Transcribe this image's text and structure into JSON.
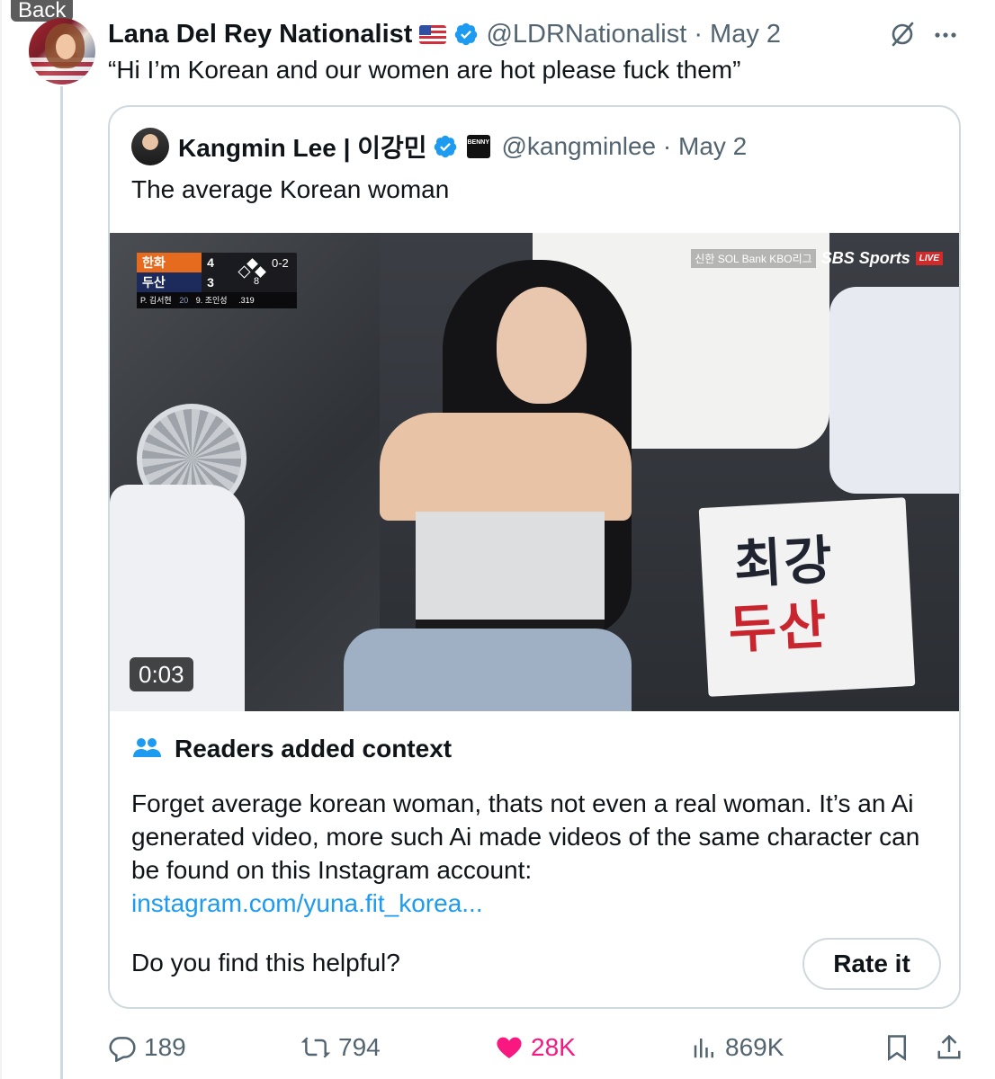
{
  "nav": {
    "back_label": "Back"
  },
  "tweet": {
    "display_name": "Lana Del Rey Nationalist",
    "handle_date": "@LDRNationalist · May 2",
    "text": "“Hi I’m Korean and our women are hot please fuck them”",
    "flag_icon": "us-flag-icon",
    "verified_color": "#1d9bf0"
  },
  "quote": {
    "display_name": "Kangmin Lee | 이강민",
    "handle_date": "@kangminlee · May 2",
    "text": "The average Korean woman",
    "affiliate_badge": "BENNY\nSHOW"
  },
  "video": {
    "duration": "0:03",
    "scorebug": {
      "team1": "한화",
      "score1": "4",
      "team2": "두산",
      "score2": "3",
      "count": "0-2",
      "outs": "8",
      "pitcher": "P. 김서현",
      "batter": "9. 조인성",
      "avg": ".319",
      "pitch_count": "20"
    },
    "broadcast": {
      "sponsor": "신한 SOL Bank KBO리그",
      "network": "SBS Sports",
      "live": "LIVE"
    },
    "sign": {
      "line1": "최강",
      "line2": "두산"
    }
  },
  "community_note": {
    "title": "Readers added context",
    "body": "Forget average korean woman, thats not even a real woman. It’s an Ai generated video, more such Ai made videos of the same character can be found on this Instagram account:",
    "link": "instagram.com/yuna.fit_korea...",
    "helpful_prompt": "Do you find this helpful?",
    "rate_label": "Rate it"
  },
  "actions": {
    "replies": "189",
    "reposts": "794",
    "likes": "28K",
    "views": "869K",
    "like_color": "#f91880"
  }
}
